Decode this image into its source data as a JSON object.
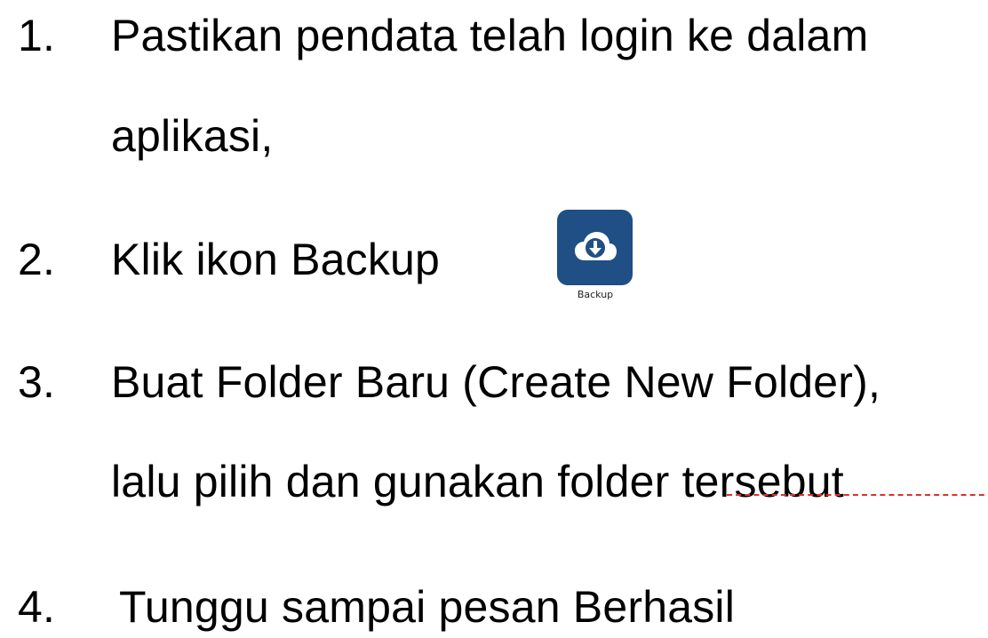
{
  "steps": [
    {
      "number": "1.",
      "lines": [
        "Pastikan pendata telah login ke dalam",
        "aplikasi,"
      ]
    },
    {
      "number": "2.",
      "lines": [
        "Klik ikon Backup"
      ],
      "icon": {
        "name": "cloud-download-icon",
        "label": "Backup",
        "background": "#1f4f85"
      }
    },
    {
      "number": "3.",
      "lines": [
        "Buat Folder Baru (Create New Folder),",
        "lalu pilih dan gunakan folder tersebut"
      ]
    },
    {
      "number": "4.",
      "lines": [
        "Tunggu sampai pesan Berhasil"
      ]
    }
  ],
  "colors": {
    "text": "#000000",
    "annotation_dash": "#d9342b"
  }
}
